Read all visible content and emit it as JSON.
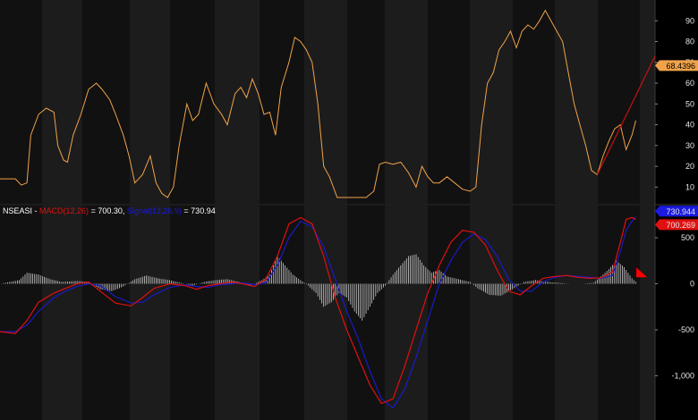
{
  "colors": {
    "background": "#000000",
    "band_dark": "#111111",
    "band_light": "#1c1c1c",
    "rsi_line": "#f0a24a",
    "trendline": "#c41010",
    "macd_line": "#e01010",
    "signal_line": "#1a1ac8",
    "histogram": "#cfcfcf",
    "axis_text": "#e6e6e6",
    "rsi_tag_bg": "#f0a24a",
    "signal_tag_bg": "#1a1ae0",
    "macd_tag_bg": "#e01010"
  },
  "legend": {
    "symbol": "NSEASI",
    "macd_label": "MACD(12,26)",
    "macd_value": " = 700.30, ",
    "signal_label": "Signal(12,26,9)",
    "signal_value": " = 730.94"
  },
  "tags": {
    "rsi_last": "68.4396",
    "signal_last": "730.944",
    "macd_last": "700.269"
  },
  "chart_data": [
    {
      "type": "line",
      "panel": "top",
      "yticks": [
        "10",
        "20",
        "30",
        "40",
        "50",
        "60",
        "70",
        "80",
        "90"
      ],
      "ylim": [
        2,
        100
      ],
      "x_count": 340,
      "series": [
        {
          "key": "rsi",
          "points": [
            [
              0,
              14
            ],
            [
              8,
              14
            ],
            [
              11,
              11
            ],
            [
              14,
              12
            ],
            [
              16,
              35
            ],
            [
              20,
              45
            ],
            [
              24,
              48
            ],
            [
              28,
              46
            ],
            [
              30,
              30
            ],
            [
              33,
              23
            ],
            [
              35,
              22
            ],
            [
              38,
              35
            ],
            [
              42,
              45
            ],
            [
              46,
              57
            ],
            [
              50,
              60
            ],
            [
              53,
              57
            ],
            [
              57,
              52
            ],
            [
              60,
              45
            ],
            [
              64,
              35
            ],
            [
              67,
              25
            ],
            [
              70,
              12
            ],
            [
              74,
              16
            ],
            [
              78,
              25
            ],
            [
              81,
              12
            ],
            [
              84,
              7
            ],
            [
              87,
              5
            ],
            [
              90,
              10
            ],
            [
              93,
              30
            ],
            [
              97,
              50
            ],
            [
              100,
              42
            ],
            [
              103,
              45
            ],
            [
              107,
              60
            ],
            [
              111,
              50
            ],
            [
              115,
              45
            ],
            [
              118,
              40
            ],
            [
              122,
              55
            ],
            [
              125,
              58
            ],
            [
              128,
              53
            ],
            [
              131,
              62
            ],
            [
              134,
              55
            ],
            [
              137,
              45
            ],
            [
              140,
              46
            ],
            [
              143,
              35
            ],
            [
              146,
              58
            ],
            [
              150,
              70
            ],
            [
              153,
              82
            ],
            [
              156,
              80
            ],
            [
              159,
              76
            ],
            [
              162,
              70
            ],
            [
              165,
              50
            ],
            [
              168,
              20
            ],
            [
              171,
              15
            ],
            [
              175,
              5
            ],
            [
              180,
              5
            ],
            [
              185,
              5
            ],
            [
              190,
              5
            ],
            [
              194,
              8
            ],
            [
              197,
              21
            ],
            [
              200,
              22
            ],
            [
              204,
              21
            ],
            [
              208,
              22
            ],
            [
              212,
              17
            ],
            [
              216,
              10
            ],
            [
              219,
              20
            ],
            [
              222,
              15
            ],
            [
              225,
              12
            ],
            [
              228,
              12
            ],
            [
              232,
              15
            ],
            [
              236,
              12
            ],
            [
              240,
              9
            ],
            [
              244,
              8
            ],
            [
              247,
              10
            ],
            [
              250,
              40
            ],
            [
              253,
              60
            ],
            [
              256,
              65
            ],
            [
              259,
              76
            ],
            [
              262,
              80
            ],
            [
              265,
              85
            ],
            [
              268,
              77
            ],
            [
              271,
              85
            ],
            [
              274,
              88
            ],
            [
              277,
              86
            ],
            [
              280,
              90
            ],
            [
              283,
              95
            ],
            [
              286,
              90
            ],
            [
              289,
              85
            ],
            [
              292,
              80
            ],
            [
              295,
              65
            ],
            [
              298,
              50
            ],
            [
              301,
              40
            ],
            [
              304,
              30
            ],
            [
              307,
              18
            ],
            [
              310,
              16
            ],
            [
              313,
              25
            ],
            [
              316,
              32
            ],
            [
              319,
              38
            ],
            [
              322,
              40
            ],
            [
              325,
              28
            ],
            [
              328,
              35
            ],
            [
              330,
              42
            ]
          ]
        }
      ]
    },
    {
      "type": "bar",
      "panel": "bottom",
      "yticks": [
        "500",
        "0",
        "-500",
        "-1,000"
      ],
      "ylim": [
        -1480,
        850
      ],
      "x_count": 340,
      "series": [
        {
          "key": "macd",
          "name": "MACD(12,26)",
          "points": [
            [
              0,
              -520
            ],
            [
              8,
              -540
            ],
            [
              14,
              -400
            ],
            [
              20,
              -200
            ],
            [
              28,
              -100
            ],
            [
              34,
              -50
            ],
            [
              40,
              0
            ],
            [
              46,
              20
            ],
            [
              52,
              -80
            ],
            [
              60,
              -210
            ],
            [
              68,
              -240
            ],
            [
              74,
              -150
            ],
            [
              80,
              -50
            ],
            [
              88,
              0
            ],
            [
              96,
              -20
            ],
            [
              102,
              -60
            ],
            [
              108,
              -20
            ],
            [
              114,
              0
            ],
            [
              120,
              20
            ],
            [
              126,
              0
            ],
            [
              132,
              -30
            ],
            [
              138,
              50
            ],
            [
              144,
              300
            ],
            [
              150,
              650
            ],
            [
              156,
              720
            ],
            [
              162,
              650
            ],
            [
              168,
              300
            ],
            [
              174,
              -150
            ],
            [
              180,
              -500
            ],
            [
              186,
              -800
            ],
            [
              192,
              -1100
            ],
            [
              198,
              -1300
            ],
            [
              204,
              -1250
            ],
            [
              210,
              -900
            ],
            [
              216,
              -500
            ],
            [
              222,
              -100
            ],
            [
              228,
              200
            ],
            [
              234,
              450
            ],
            [
              240,
              580
            ],
            [
              246,
              560
            ],
            [
              252,
              420
            ],
            [
              258,
              150
            ],
            [
              264,
              -80
            ],
            [
              270,
              -120
            ],
            [
              276,
              -20
            ],
            [
              282,
              60
            ],
            [
              288,
              80
            ],
            [
              294,
              90
            ],
            [
              300,
              70
            ],
            [
              306,
              60
            ],
            [
              312,
              65
            ],
            [
              318,
              130
            ],
            [
              322,
              450
            ],
            [
              325,
              700
            ],
            [
              328,
              720
            ],
            [
              330,
              700
            ]
          ]
        },
        {
          "key": "signal",
          "name": "Signal(12,26,9)",
          "points": [
            [
              0,
              -520
            ],
            [
              8,
              -520
            ],
            [
              14,
              -450
            ],
            [
              20,
              -300
            ],
            [
              28,
              -150
            ],
            [
              34,
              -80
            ],
            [
              40,
              -30
            ],
            [
              46,
              0
            ],
            [
              52,
              -20
            ],
            [
              60,
              -140
            ],
            [
              68,
              -210
            ],
            [
              74,
              -200
            ],
            [
              80,
              -120
            ],
            [
              88,
              -40
            ],
            [
              96,
              -10
            ],
            [
              102,
              -30
            ],
            [
              108,
              -40
            ],
            [
              114,
              -10
            ],
            [
              120,
              0
            ],
            [
              126,
              10
            ],
            [
              132,
              -10
            ],
            [
              138,
              10
            ],
            [
              144,
              200
            ],
            [
              150,
              500
            ],
            [
              156,
              680
            ],
            [
              162,
              620
            ],
            [
              168,
              400
            ],
            [
              174,
              50
            ],
            [
              180,
              -300
            ],
            [
              186,
              -600
            ],
            [
              192,
              -950
            ],
            [
              198,
              -1250
            ],
            [
              204,
              -1350
            ],
            [
              210,
              -1150
            ],
            [
              216,
              -800
            ],
            [
              222,
              -400
            ],
            [
              228,
              0
            ],
            [
              234,
              250
            ],
            [
              240,
              450
            ],
            [
              246,
              540
            ],
            [
              252,
              480
            ],
            [
              258,
              300
            ],
            [
              264,
              50
            ],
            [
              270,
              -80
            ],
            [
              276,
              -80
            ],
            [
              282,
              20
            ],
            [
              288,
              70
            ],
            [
              294,
              90
            ],
            [
              300,
              80
            ],
            [
              306,
              70
            ],
            [
              312,
              60
            ],
            [
              318,
              90
            ],
            [
              322,
              350
            ],
            [
              325,
              580
            ],
            [
              328,
              680
            ],
            [
              330,
              730
            ]
          ]
        },
        {
          "key": "histogram",
          "points": [
            [
              0,
              0
            ],
            [
              10,
              40
            ],
            [
              14,
              120
            ],
            [
              20,
              100
            ],
            [
              26,
              50
            ],
            [
              32,
              20
            ],
            [
              40,
              30
            ],
            [
              46,
              20
            ],
            [
              52,
              -60
            ],
            [
              58,
              -80
            ],
            [
              64,
              -30
            ],
            [
              70,
              50
            ],
            [
              76,
              90
            ],
            [
              82,
              60
            ],
            [
              88,
              40
            ],
            [
              94,
              10
            ],
            [
              100,
              -20
            ],
            [
              106,
              20
            ],
            [
              112,
              40
            ],
            [
              118,
              50
            ],
            [
              124,
              20
            ],
            [
              130,
              -20
            ],
            [
              136,
              40
            ],
            [
              140,
              100
            ],
            [
              144,
              300
            ],
            [
              148,
              200
            ],
            [
              152,
              100
            ],
            [
              156,
              40
            ],
            [
              160,
              -20
            ],
            [
              164,
              -100
            ],
            [
              168,
              -250
            ],
            [
              172,
              -200
            ],
            [
              176,
              -100
            ],
            [
              180,
              -150
            ],
            [
              184,
              -300
            ],
            [
              188,
              -400
            ],
            [
              192,
              -250
            ],
            [
              196,
              -100
            ],
            [
              200,
              -20
            ],
            [
              204,
              100
            ],
            [
              208,
              200
            ],
            [
              212,
              300
            ],
            [
              216,
              320
            ],
            [
              220,
              200
            ],
            [
              224,
              120
            ],
            [
              228,
              150
            ],
            [
              232,
              80
            ],
            [
              236,
              60
            ],
            [
              240,
              40
            ],
            [
              244,
              20
            ],
            [
              248,
              -50
            ],
            [
              254,
              -120
            ],
            [
              260,
              -130
            ],
            [
              266,
              -60
            ],
            [
              272,
              20
            ],
            [
              278,
              40
            ],
            [
              284,
              20
            ],
            [
              290,
              10
            ],
            [
              296,
              0
            ],
            [
              302,
              0
            ],
            [
              308,
              10
            ],
            [
              312,
              80
            ],
            [
              316,
              160
            ],
            [
              320,
              250
            ],
            [
              324,
              180
            ],
            [
              328,
              60
            ],
            [
              330,
              20
            ]
          ]
        }
      ]
    }
  ]
}
